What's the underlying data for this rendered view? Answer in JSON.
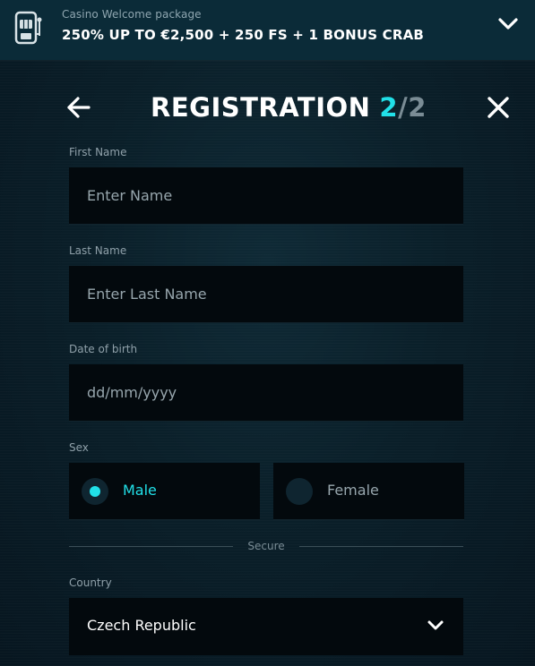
{
  "promo": {
    "subtitle": "Casino Welcome package",
    "title": "250% UP TO €2,500 + 250 FS + 1 BONUS CRAB"
  },
  "header": {
    "title": "REGISTRATION",
    "step_current": "2",
    "step_separator": "/",
    "step_total": "2"
  },
  "form": {
    "first_name": {
      "label": "First Name",
      "placeholder": "Enter Name",
      "value": ""
    },
    "last_name": {
      "label": "Last Name",
      "placeholder": "Enter Last Name",
      "value": ""
    },
    "dob": {
      "label": "Date of birth",
      "placeholder": "dd/mm/yyyy",
      "value": ""
    },
    "sex": {
      "label": "Sex",
      "options": [
        {
          "label": "Male",
          "selected": true
        },
        {
          "label": "Female",
          "selected": false
        }
      ]
    },
    "divider_text": "Secure",
    "country": {
      "label": "Country",
      "value": "Czech Republic"
    }
  },
  "icons": {
    "promo": "slot-machine-icon",
    "expand": "chevron-down-icon",
    "back": "arrow-left-icon",
    "close": "close-icon",
    "select": "chevron-down-icon"
  },
  "colors": {
    "accent": "#21e0e8",
    "field_bg": "#03090d",
    "promo_bg": "#0b2b38",
    "muted_text": "#97a6ad"
  }
}
